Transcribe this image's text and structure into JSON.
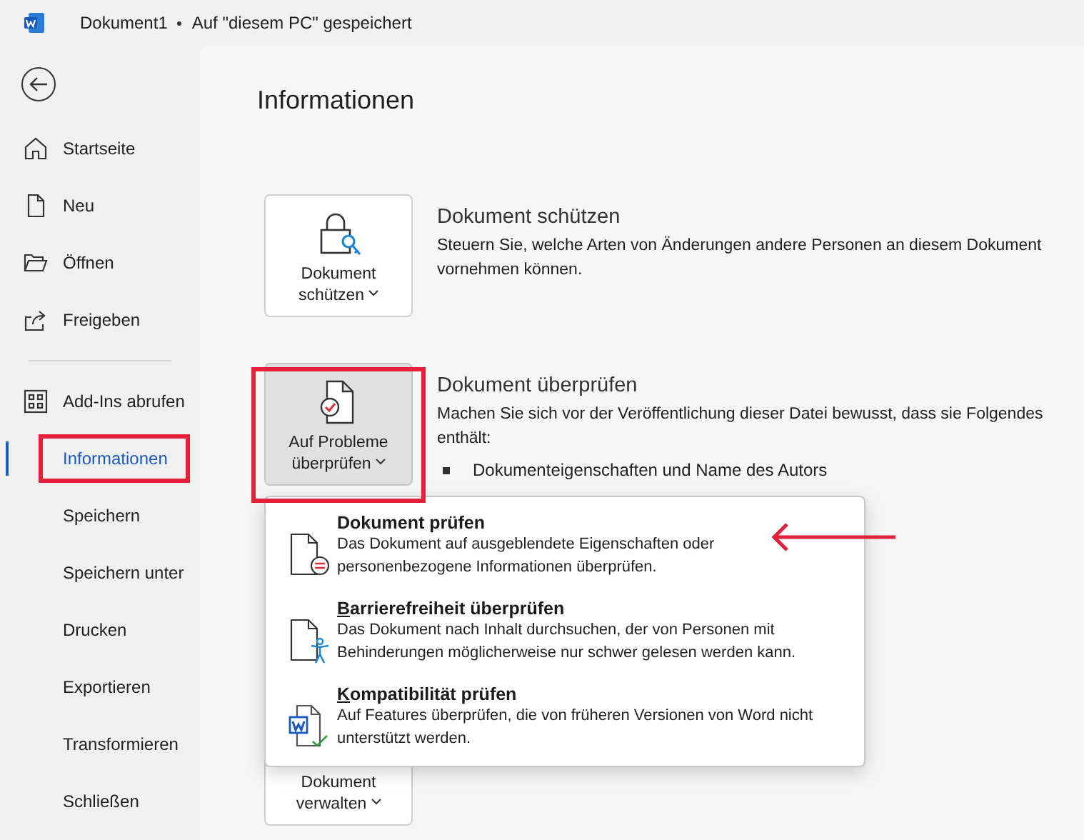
{
  "window": {
    "title": "Dokument1",
    "status": "Auf \"diesem PC\" gespeichert"
  },
  "sidebar": {
    "items": [
      {
        "label": "Startseite",
        "kind": "home",
        "selected": false
      },
      {
        "label": "Neu",
        "kind": "new",
        "selected": false
      },
      {
        "label": "Öffnen",
        "kind": "open",
        "selected": false
      },
      {
        "label": "Freigeben",
        "kind": "share",
        "selected": false,
        "divider_after": true
      },
      {
        "label": "Add-Ins abrufen",
        "kind": "addins",
        "selected": false
      },
      {
        "label": "Informationen",
        "selected": true
      },
      {
        "label": "Speichern",
        "selected": false
      },
      {
        "label": "Speichern unter",
        "selected": false
      },
      {
        "label": "Drucken",
        "selected": false
      },
      {
        "label": "Exportieren",
        "selected": false
      },
      {
        "label": "Transformieren",
        "selected": false
      },
      {
        "label": "Schließen",
        "selected": false
      }
    ]
  },
  "page": {
    "title": "Informationen",
    "sections": [
      {
        "button": [
          "Dokument",
          "schützen"
        ],
        "kind": "lock",
        "pressed": false,
        "heading": "Dokument schützen",
        "description": "Steuern Sie, welche Arten von Änderungen andere Personen an diesem Dokument vornehmen können."
      },
      {
        "button": [
          "Auf Probleme",
          "überprüfen"
        ],
        "kind": "inspect",
        "pressed": true,
        "heading": "Dokument überprüfen",
        "description": "Machen Sie sich vor der Veröffentlichung dieser Datei bewusst, dass sie Folgendes enthält:",
        "bullets": [
          "Dokumenteigenschaften und Name des Autors"
        ]
      },
      {
        "button": [
          "Dokument",
          "verwalten"
        ],
        "pressed": false
      }
    ]
  },
  "menu": {
    "items": [
      {
        "kind": "inspect",
        "title": "Dokument prüfen",
        "mnemonic": false,
        "description": "Das Dokument auf ausgeblendete Eigenschaften oder personenbezogene Informationen überprüfen."
      },
      {
        "kind": "accessibility",
        "title": "Barrierefreiheit überprüfen",
        "mnemonic": true,
        "description": "Das Dokument nach Inhalt durchsuchen, der von Personen mit Behinderungen möglicherweise nur schwer gelesen werden kann."
      },
      {
        "kind": "compat",
        "title": "Kompatibilität prüfen",
        "mnemonic": true,
        "description": "Auf Features überprüfen, die von früheren Versionen von Word nicht unterstützt werden."
      }
    ]
  }
}
